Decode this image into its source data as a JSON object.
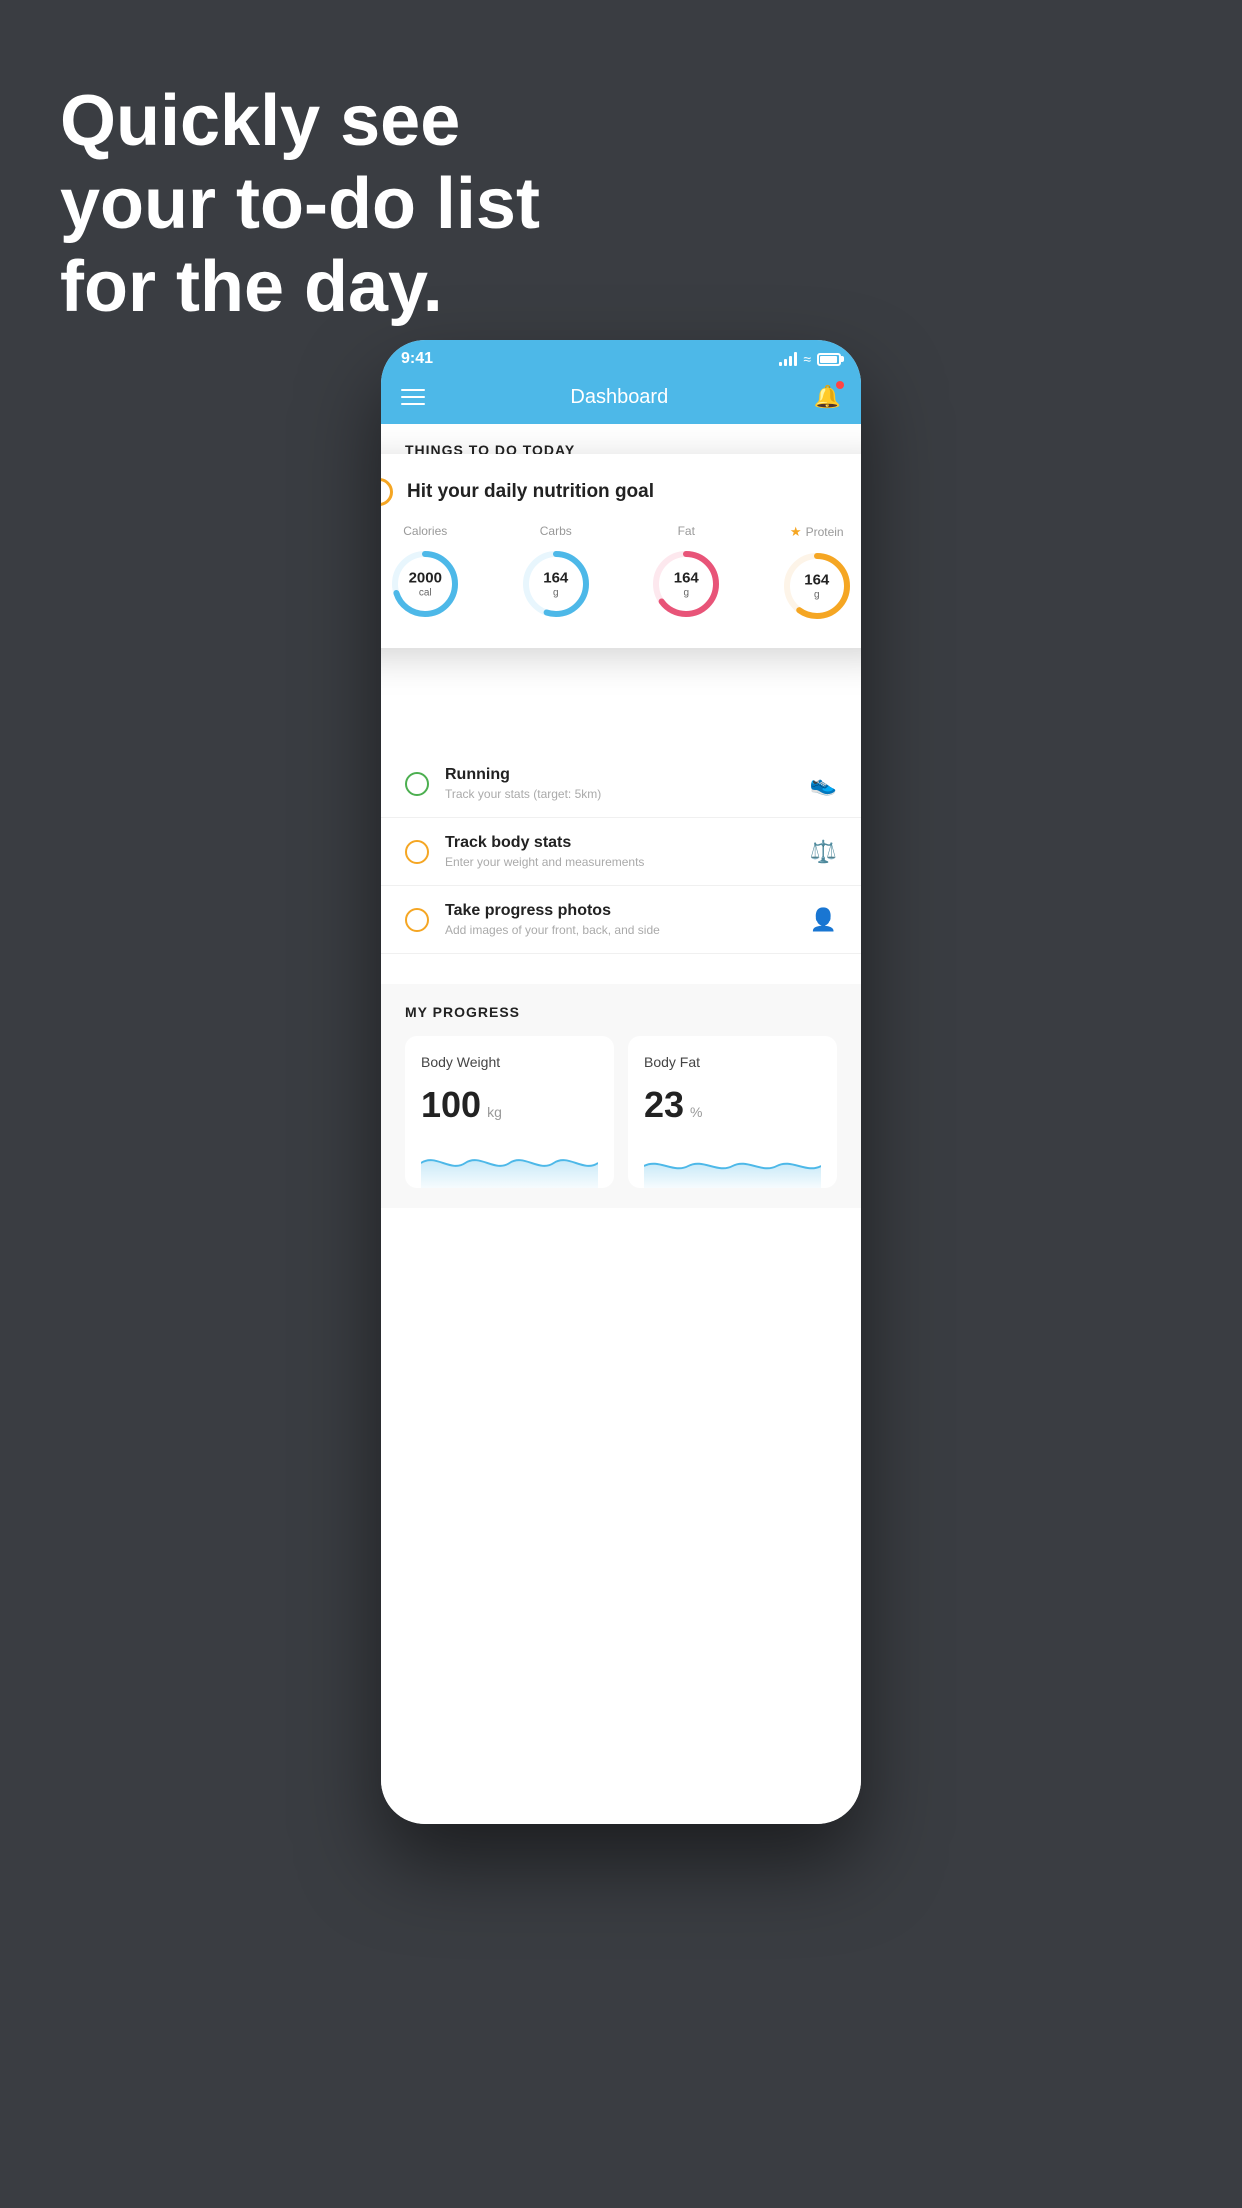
{
  "headline": {
    "line1": "Quickly see",
    "line2": "your to-do list",
    "line3": "for the day."
  },
  "status_bar": {
    "time": "9:41"
  },
  "nav": {
    "title": "Dashboard"
  },
  "things_today_header": "THINGS TO DO TODAY",
  "floating_card": {
    "title": "Hit your daily nutrition goal",
    "nutrition": [
      {
        "label": "Calories",
        "value": "2000",
        "unit": "cal",
        "color": "#4db8e8",
        "track_color": "#e8f6fd",
        "percent": 70
      },
      {
        "label": "Carbs",
        "value": "164",
        "unit": "g",
        "color": "#4db8e8",
        "track_color": "#e8f6fd",
        "percent": 55
      },
      {
        "label": "Fat",
        "value": "164",
        "unit": "g",
        "color": "#e85478",
        "track_color": "#fde8ee",
        "percent": 65
      },
      {
        "label": "Protein",
        "value": "164",
        "unit": "g",
        "color": "#f5a623",
        "track_color": "#fdf4e8",
        "percent": 60,
        "starred": true
      }
    ]
  },
  "todo_items": [
    {
      "title": "Running",
      "subtitle": "Track your stats (target: 5km)",
      "checkbox_color": "#4caf50",
      "icon": "👟"
    },
    {
      "title": "Track body stats",
      "subtitle": "Enter your weight and measurements",
      "checkbox_color": "#f5a623",
      "icon": "⚖️"
    },
    {
      "title": "Take progress photos",
      "subtitle": "Add images of your front, back, and side",
      "checkbox_color": "#f5a623",
      "icon": "👤"
    }
  ],
  "progress": {
    "section_title": "MY PROGRESS",
    "cards": [
      {
        "title": "Body Weight",
        "value": "100",
        "unit": "kg"
      },
      {
        "title": "Body Fat",
        "value": "23",
        "unit": "%"
      }
    ]
  }
}
